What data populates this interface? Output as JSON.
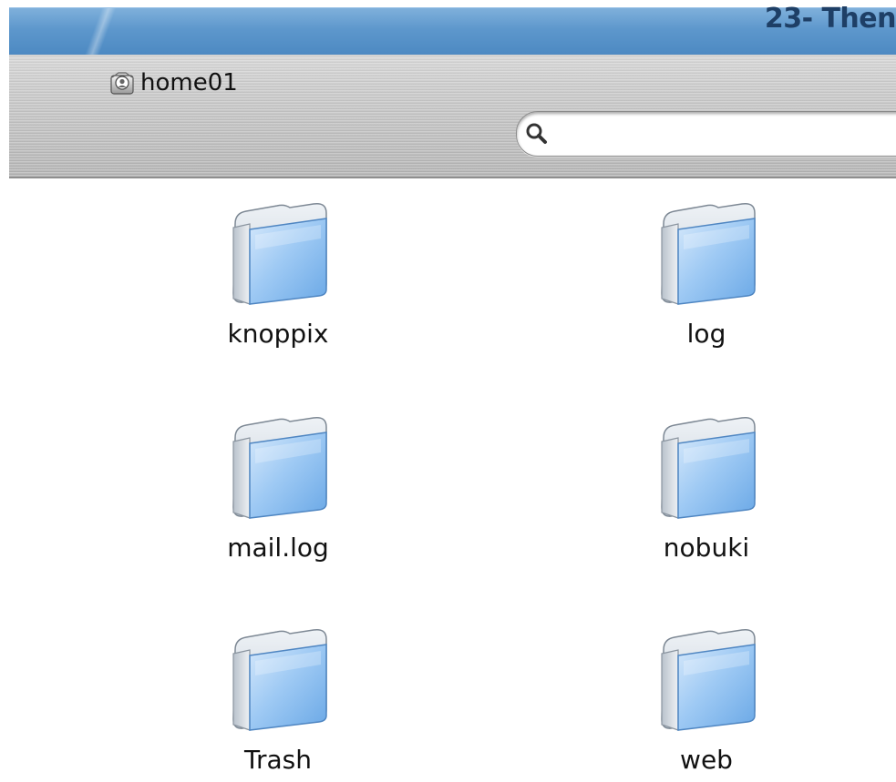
{
  "window": {
    "title": "23- Then"
  },
  "toolbar": {
    "path_label": "home01",
    "search_placeholder": "",
    "search_value": ""
  },
  "icons": {
    "path": "home-folder-icon",
    "search": "magnifier-icon",
    "item": "folder-icon"
  },
  "colors": {
    "title_bar": "#5d97cc",
    "folder_blue": "#8fc2f2"
  },
  "items": [
    {
      "label": "knoppix"
    },
    {
      "label": "log"
    },
    {
      "label": "mail.log"
    },
    {
      "label": "nobuki"
    },
    {
      "label": "Trash"
    },
    {
      "label": "web"
    }
  ]
}
